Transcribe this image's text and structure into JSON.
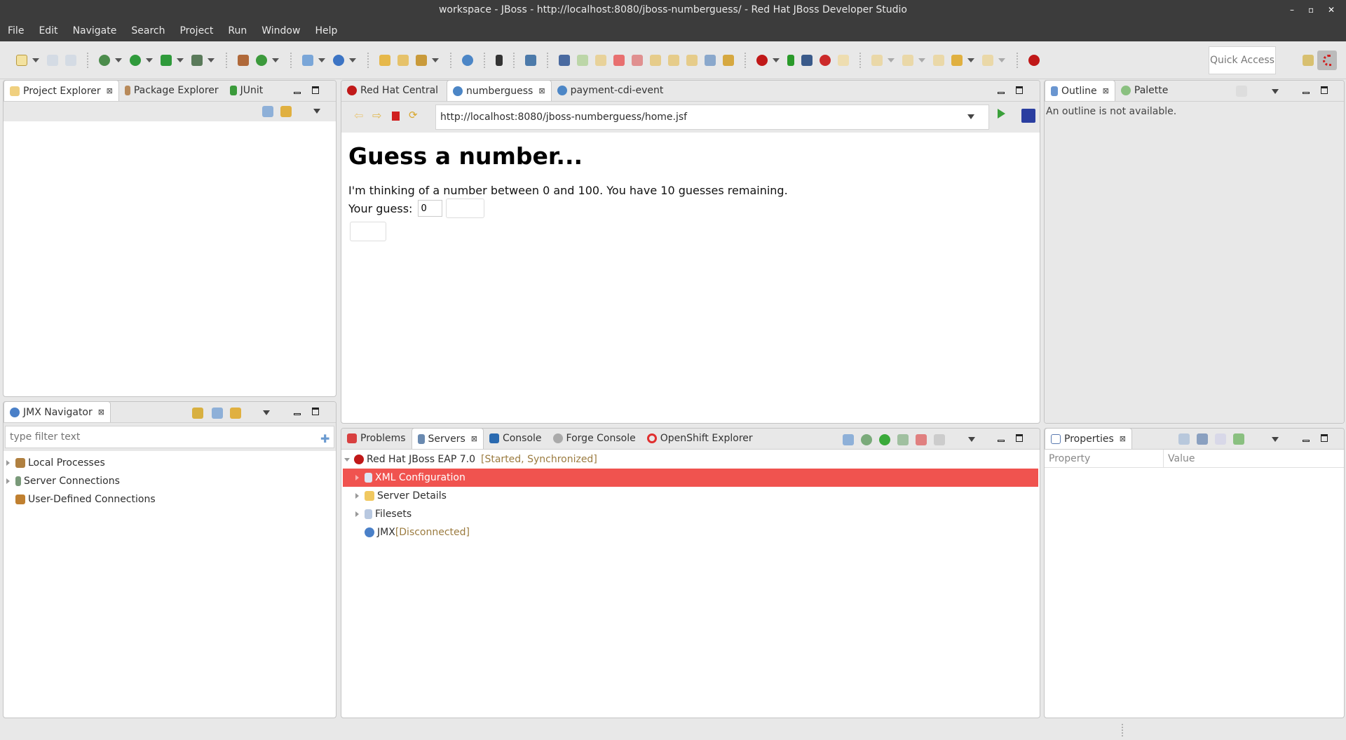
{
  "window": {
    "title": "workspace - JBoss - http://localhost:8080/jboss-numberguess/ - Red Hat JBoss Developer Studio",
    "controls": [
      "–",
      "▫",
      "✕"
    ]
  },
  "menu": [
    "File",
    "Edit",
    "Navigate",
    "Search",
    "Project",
    "Run",
    "Window",
    "Help"
  ],
  "toolbar": {
    "quick_access": "Quick Access"
  },
  "left_top": {
    "tabs": [
      "Project Explorer",
      "Package Explorer",
      "JUnit"
    ]
  },
  "jmx": {
    "tab": "JMX Navigator",
    "filter_placeholder": "type filter text",
    "items": [
      "Local Processes",
      "Server Connections",
      "User-Defined Connections"
    ]
  },
  "editor": {
    "tabs": [
      "Red Hat Central",
      "numberguess",
      "payment-cdi-event"
    ],
    "url": "http://localhost:8080/jboss-numberguess/home.jsf",
    "page": {
      "heading": "Guess a number...",
      "text": "I'm thinking of a number between 0 and 100. You have 10 guesses remaining.",
      "guess_label": "Your guess:",
      "guess_value": "0"
    }
  },
  "outline": {
    "tabs": [
      "Outline",
      "Palette"
    ],
    "message": "An outline is not available."
  },
  "servers": {
    "tabs": [
      "Problems",
      "Servers",
      "Console",
      "Forge Console",
      "OpenShift Explorer"
    ],
    "server": {
      "name": "Red Hat JBoss EAP 7.0",
      "status": "[Started, Synchronized]"
    },
    "children": [
      {
        "name": "XML Configuration"
      },
      {
        "name": "Server Details"
      },
      {
        "name": "Filesets"
      }
    ],
    "jmx": {
      "name": "JMX",
      "status": "[Disconnected]"
    }
  },
  "properties": {
    "tab": "Properties",
    "columns": [
      "Property",
      "Value"
    ]
  },
  "colors": {
    "selection": "#f0534f",
    "status_text": "#9b7b3f",
    "chrome_dark": "#3c3c3c"
  }
}
